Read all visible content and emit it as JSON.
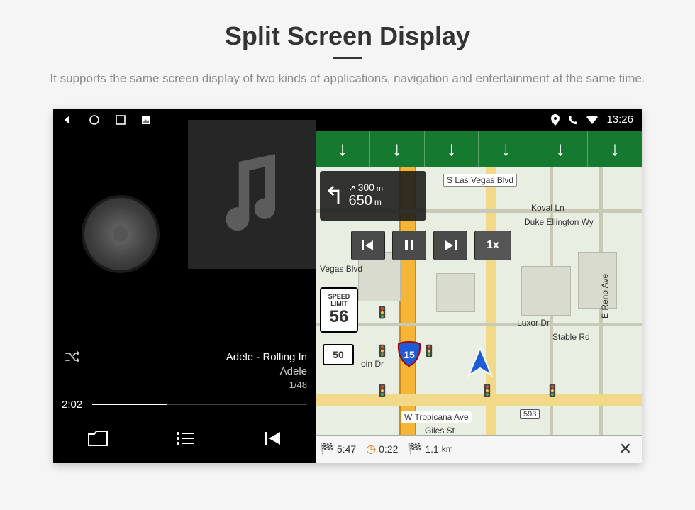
{
  "hero": {
    "title": "Split Screen Display",
    "subtitle": "It supports the same screen display of two kinds of applications, navigation and entertainment at the same time."
  },
  "statusbar": {
    "time": "13:26"
  },
  "player": {
    "track_title": "Adele - Rolling In",
    "artist": "Adele",
    "index": "1/48",
    "elapsed": "2:02"
  },
  "nav": {
    "turn": {
      "next_m": "300",
      "next_unit": "m",
      "current_m": "650",
      "current_unit": "m"
    },
    "speed_label_top": "SPEED",
    "speed_label_mid": "LIMIT",
    "speed_limit": "56",
    "route_shield": "50",
    "interstate": "15",
    "playback_speed": "1x",
    "roads": {
      "s_las_vegas": "S Las Vegas Blvd",
      "koval": "Koval Ln",
      "duke": "Duke Ellington Wy",
      "vegas_blvd": "Vegas Blvd",
      "luxor": "Luxor Dr",
      "stable": "Stable Rd",
      "reno": "E Reno Ave",
      "tropicana": "W Tropicana Ave",
      "tropicana_exit": "593",
      "giles": "Giles St",
      "oin": "oin Dr"
    },
    "bottom": {
      "eta": "5:47",
      "speed": "0:22",
      "dist_val": "1.1",
      "dist_unit": "km"
    }
  }
}
